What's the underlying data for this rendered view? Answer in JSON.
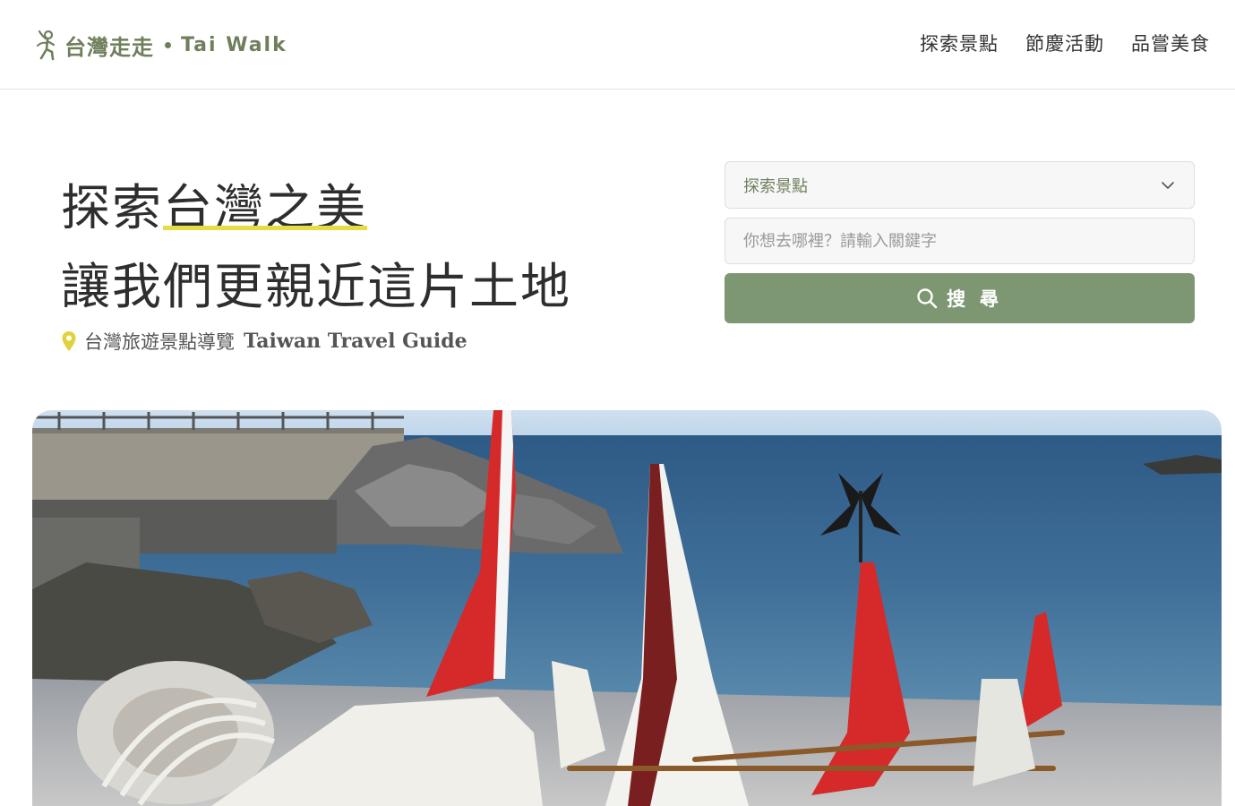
{
  "header": {
    "logo_text": "台灣走走",
    "logo_en": "Tai Walk",
    "nav": [
      {
        "label": "探索景點"
      },
      {
        "label": "節慶活動"
      },
      {
        "label": "品嘗美食"
      }
    ]
  },
  "hero": {
    "title_line1_pre": "探索",
    "title_line1_highlight": "台灣之美",
    "title_line2": "讓我們更親近這片土地",
    "subtitle_zh": "台灣旅遊景點導覽",
    "subtitle_en": "Taiwan Travel Guide"
  },
  "search": {
    "category_selected": "探索景點",
    "keyword_placeholder": "你想去哪裡？請輸入關鍵字",
    "keyword_value": "",
    "button_label": "搜 尋"
  },
  "icons": {
    "logo": "walking-figure-icon",
    "pin": "map-pin-icon",
    "chevron": "chevron-down-icon",
    "search": "search-icon"
  },
  "colors": {
    "brand_green": "#7d9772",
    "logo_green": "#6f7f5c",
    "highlight_yellow": "#e6dc45"
  }
}
